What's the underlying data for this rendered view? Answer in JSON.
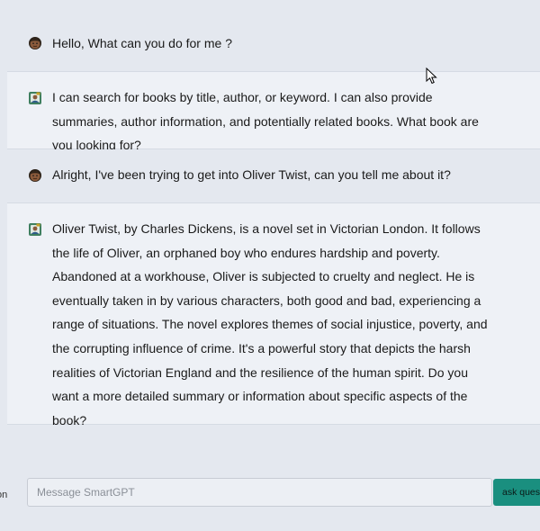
{
  "sidebar": {
    "edge_text": "on"
  },
  "messages": [
    {
      "role": "user",
      "avatar_icon": "user-avatar-icon",
      "text": "Hello, What can you do for me ?"
    },
    {
      "role": "assistant",
      "avatar_icon": "bot-avatar-icon",
      "text": "I can search for books by title, author, or keyword. I can also provide summaries, author information, and potentially related books. What book are you looking for?"
    },
    {
      "role": "user",
      "avatar_icon": "user-avatar-icon",
      "text": "Alright, I've been trying to get into Oliver Twist, can you tell me about it?"
    },
    {
      "role": "assistant",
      "avatar_icon": "bot-avatar-icon",
      "text": "Oliver Twist, by Charles Dickens, is a novel set in Victorian London. It follows the life of Oliver, an orphaned boy who endures hardship and poverty. Abandoned at a workhouse, Oliver is subjected to cruelty and neglect. He is eventually taken in by various characters, both good and bad, experiencing a range of situations. The novel explores themes of social injustice, poverty, and the corrupting influence of crime. It's a powerful story that depicts the harsh realities of Victorian England and the resilience of the human spirit. Do you want a more detailed summary or information about specific aspects of the book?"
    }
  ],
  "composer": {
    "placeholder": "Message SmartGPT",
    "value": ""
  },
  "send_button": {
    "label": "ask question"
  },
  "colors": {
    "page_background": "#e4e8ef",
    "assistant_background": "#eef1f6",
    "accent": "#1a8f7f"
  }
}
